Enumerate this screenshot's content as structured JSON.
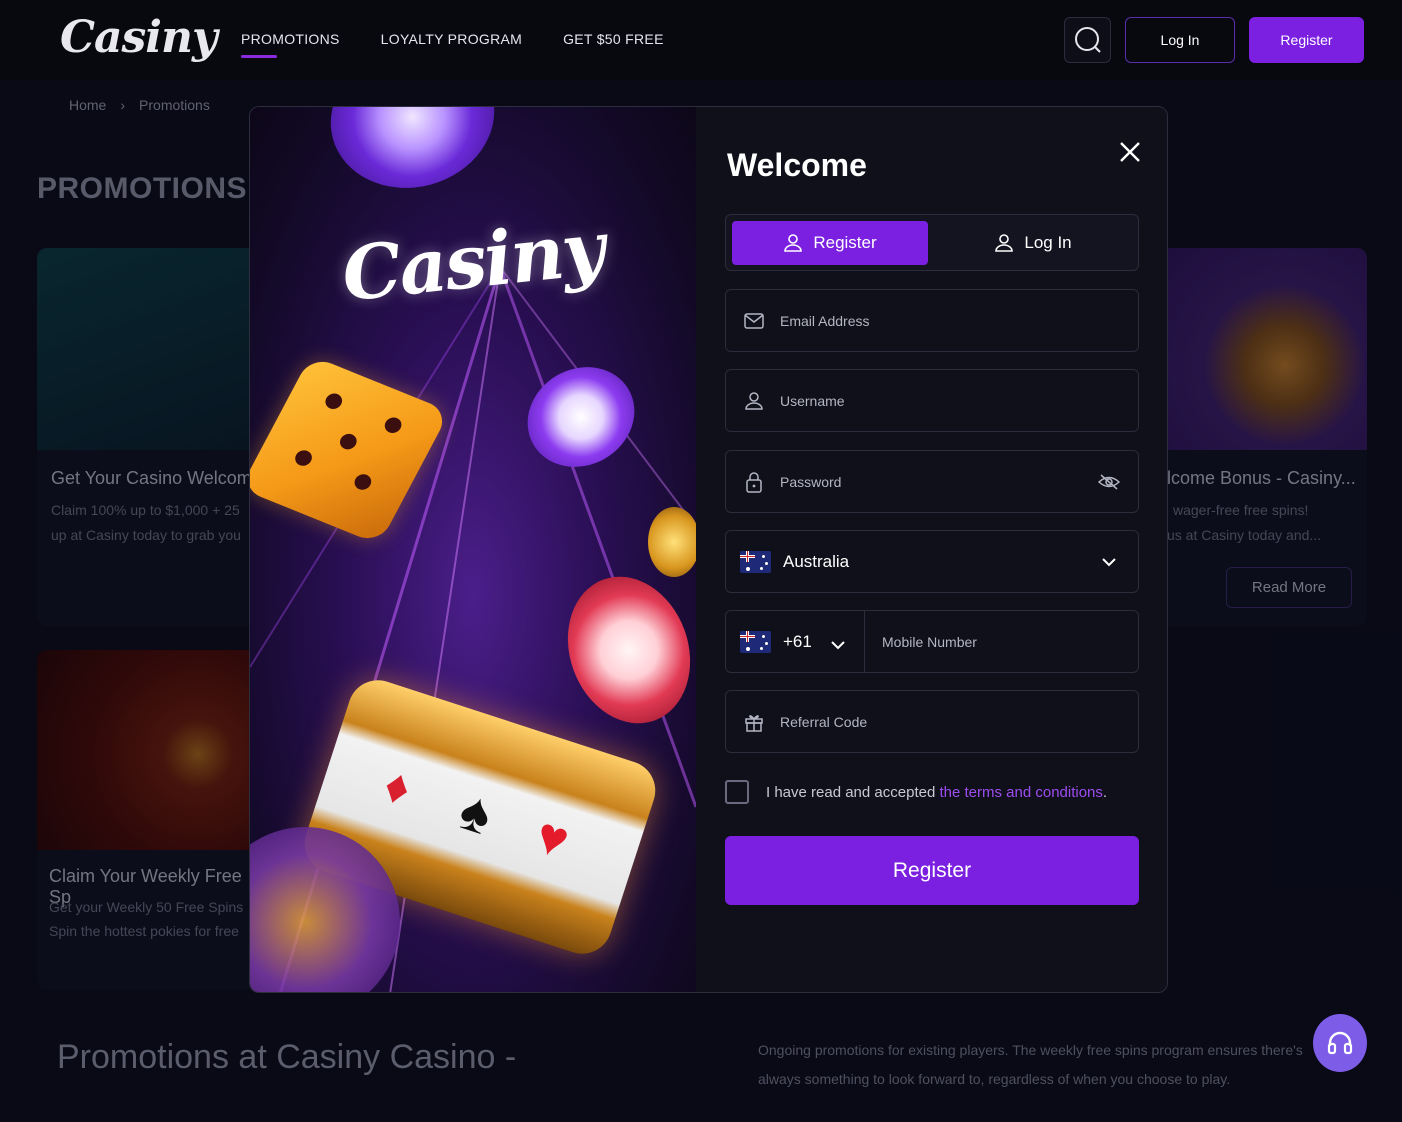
{
  "header": {
    "logo": "Casiny",
    "nav": [
      "PROMOTIONS",
      "LOYALTY PROGRAM",
      "GET $50 FREE"
    ],
    "login_label": "Log In",
    "register_label": "Register"
  },
  "breadcrumb": {
    "home": "Home",
    "sep": "›",
    "current": "Promotions"
  },
  "page": {
    "title": "PROMOTIONS",
    "cards": [
      {
        "title": "Get Your Casino Welcome",
        "line1": "Claim 100% up to $1,000 + 25",
        "line2": "up at Casiny today to grab you"
      },
      {
        "title": "lcome Bonus - Casiny...",
        "line1": "wager-free free spins!",
        "line2": "us at Casiny today and..."
      },
      {
        "title": "Claim Your Weekly Free Sp",
        "line1": "Get your Weekly 50 Free Spins",
        "line2": "Spin the hottest pokies for free"
      }
    ],
    "read_more": "Read More",
    "bottom_title": "Promotions at Casiny Casino -",
    "bottom_text": "Ongoing promotions for existing players. The weekly free spins program ensures there's always something to look forward to, regardless of when you choose to play."
  },
  "modal": {
    "art_logo": "Casiny",
    "welcome": "Welcome",
    "tabs": {
      "register": "Register",
      "login": "Log In"
    },
    "fields": {
      "email": "Email Address",
      "username": "Username",
      "password": "Password",
      "country": "Australia",
      "phone_code": "+61",
      "mobile": "Mobile Number",
      "referral": "Referral Code"
    },
    "terms_prefix": "I have read and accepted ",
    "terms_link": "the terms and conditions",
    "terms_suffix": ".",
    "submit": "Register"
  },
  "icons": {
    "search": "search-icon",
    "close": "close-icon",
    "user": "user-icon",
    "mail": "mail-icon",
    "lock": "lock-icon",
    "eye_off": "eye-off-icon",
    "chevron": "chevron-down-icon",
    "gift": "gift-icon",
    "support": "headset-icon"
  },
  "colors": {
    "accent": "#7b1fe0",
    "link": "#9d4cf0",
    "background": "#0c0d1c"
  }
}
